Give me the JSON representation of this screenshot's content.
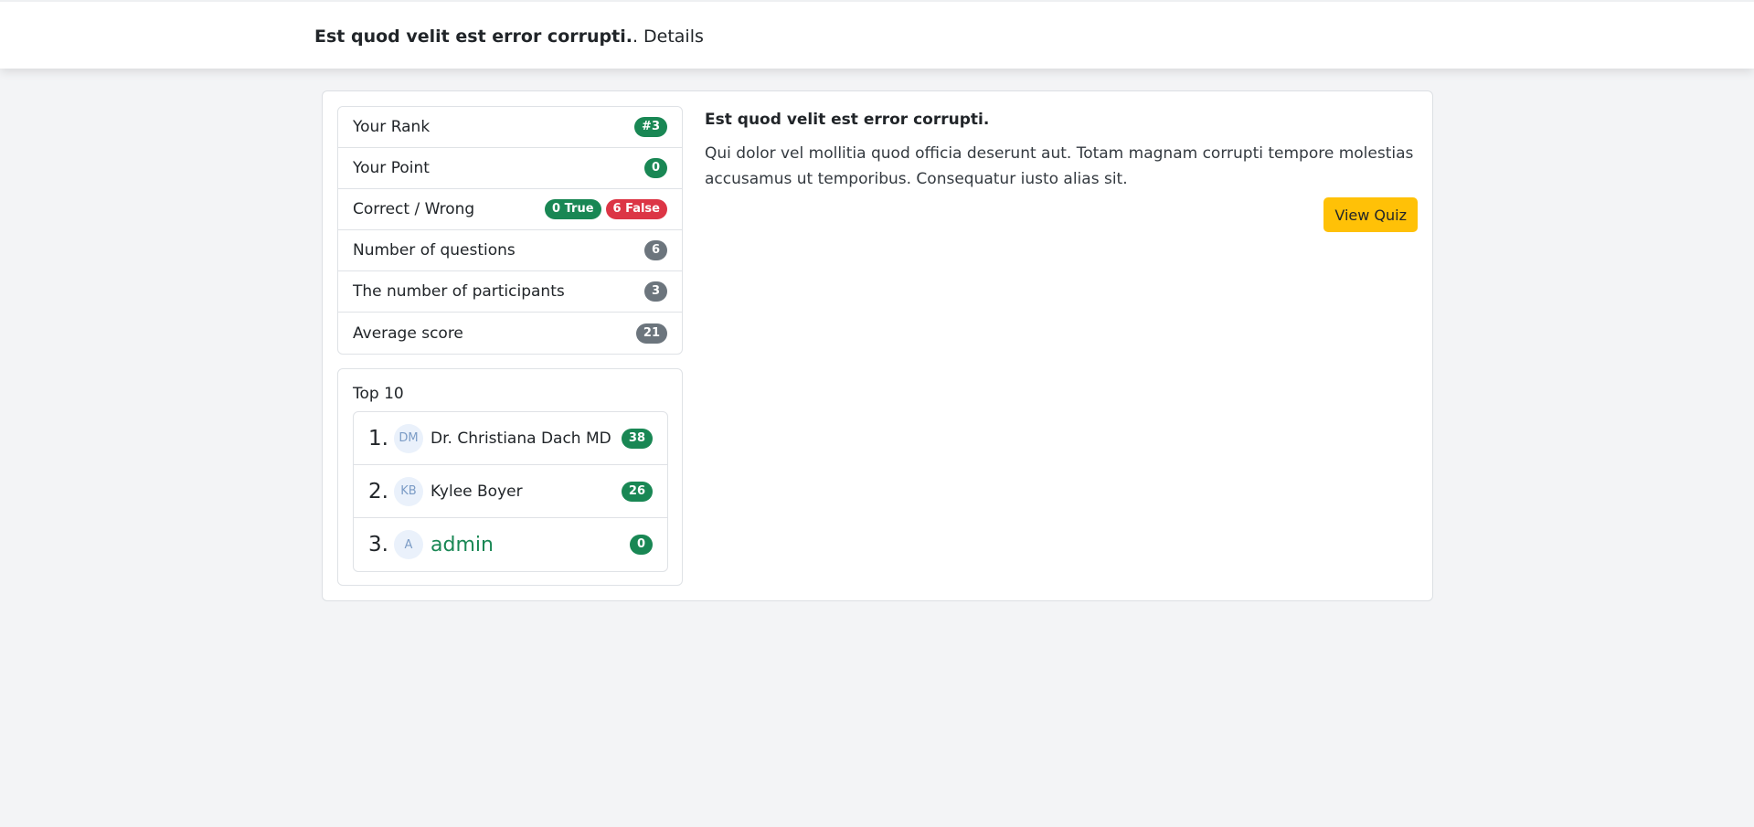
{
  "header": {
    "quiz_name": "Est quod velit est error corrupti.",
    "suffix": ". Details"
  },
  "stats": {
    "rank_label": "Your Rank",
    "rank_value": "#3",
    "point_label": "Your Point",
    "point_value": "0",
    "correct_wrong_label": "Correct / Wrong",
    "true_badge": "0 True",
    "false_badge": "6 False",
    "questions_label": "Number of questions",
    "questions_value": "6",
    "participants_label": "The number of participants",
    "participants_value": "3",
    "average_label": "Average score",
    "average_value": "21"
  },
  "top10": {
    "heading": "Top 10",
    "leaders": [
      {
        "rank": "1.",
        "initials": "DM",
        "name": "Dr. Christiana Dach MD",
        "score": "38"
      },
      {
        "rank": "2.",
        "initials": "KB",
        "name": "Kylee Boyer",
        "score": "26"
      },
      {
        "rank": "3.",
        "initials": "A",
        "name": "admin",
        "score": "0"
      }
    ]
  },
  "quiz": {
    "title": "Est quod velit est error corrupti.",
    "description": "Qui dolor vel mollitia quod officia deserunt aut. Totam magnam corrupti tempore molestias accusamus ut temporibus. Consequatur iusto alias sit.",
    "view_button": "View Quiz"
  },
  "colors": {
    "success": "#198754",
    "danger": "#dc3545",
    "secondary": "#6c757d",
    "warning": "#ffc107",
    "background": "#f3f4f6"
  }
}
